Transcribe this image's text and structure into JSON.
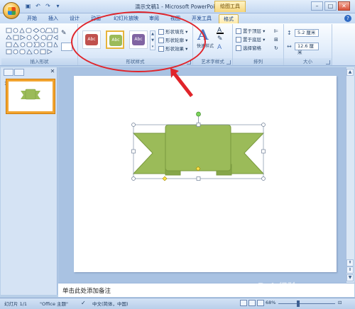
{
  "titlebar": {
    "title": "演示文稿1 - Microsoft PowerPoint",
    "context_tab_title": "绘图工具",
    "qat": [
      "save",
      "undo",
      "redo",
      "customize"
    ],
    "window_controls": {
      "minimize": "–",
      "maximize": "□",
      "close": "✕"
    }
  },
  "tabs": [
    {
      "label": "开始"
    },
    {
      "label": "插入"
    },
    {
      "label": "设计"
    },
    {
      "label": "动画"
    },
    {
      "label": "幻灯片放映"
    },
    {
      "label": "审阅"
    },
    {
      "label": "视图"
    },
    {
      "label": "开发工具"
    },
    {
      "label": "格式",
      "active": true
    }
  ],
  "help": "?",
  "ribbon": {
    "insert_shapes": {
      "label": "插入形状"
    },
    "shape_styles": {
      "label": "形状样式",
      "swatches": [
        {
          "text": "Abc",
          "color": "#c0504d"
        },
        {
          "text": "Abc",
          "color": "#9bbb59",
          "selected": true
        },
        {
          "text": "Abc",
          "color": "#8064a2"
        }
      ],
      "fill": "形状填充",
      "outline": "形状轮廓",
      "effects": "形状效果"
    },
    "wordart": {
      "label": "艺术字样式",
      "quick_styles": "快速样式"
    },
    "arrange": {
      "label": "排列",
      "bring_front": "置于顶层",
      "send_back": "置于底层",
      "selection_pane": "选择窗格"
    },
    "size": {
      "label": "大小",
      "height": "5.2 厘米",
      "width": "12.6 厘米"
    }
  },
  "left_pane": {
    "slide_number": "1",
    "close": "✕"
  },
  "notes_placeholder": "单击此处添加备注",
  "status": {
    "slide": "幻灯片 1/1",
    "theme": "\"Office 主题\"",
    "language": "中文(简体，中国)",
    "zoom": "68%"
  },
  "shape": {
    "fill": "#9bbb59",
    "stroke": "#7a9a3e"
  },
  "watermark": "Bai 经验"
}
